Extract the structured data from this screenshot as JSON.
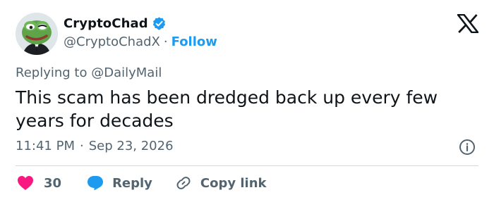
{
  "author": {
    "display_name": "CryptoChad",
    "handle": "@CryptoChadX",
    "separator": "·",
    "follow_label": "Follow",
    "verified_icon": "verified-badge-icon",
    "avatar_icon": "frog-avatar"
  },
  "reply_context": {
    "prefix": "Replying to",
    "mention": "@DailyMail"
  },
  "tweet": {
    "text": "This scam has been dredged back up every few years for decades"
  },
  "meta": {
    "time": "11:41 PM",
    "separator": "·",
    "date": "Sep 23, 2026",
    "info_icon": "info-icon"
  },
  "actions": {
    "like_count": "30",
    "reply_label": "Reply",
    "copy_label": "Copy link"
  },
  "colors": {
    "text": "#0f1419",
    "secondary": "#536471",
    "accent": "#1d9bf0",
    "like": "#f91880",
    "divider": "#cfd9de"
  }
}
